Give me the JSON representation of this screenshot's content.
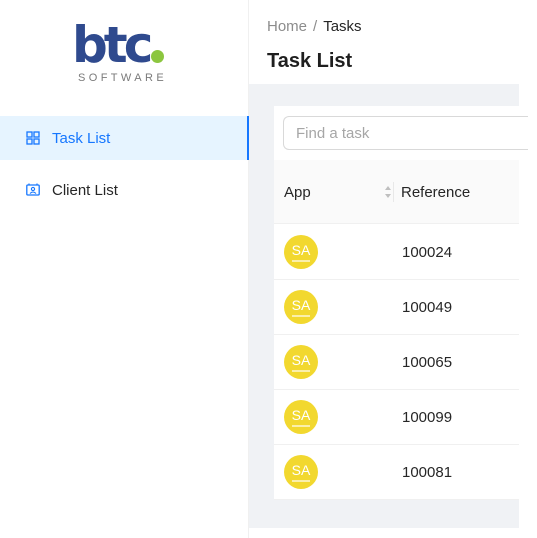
{
  "logo": {
    "wordmark": "btc",
    "subtitle": "SOFTWARE",
    "dot_color": "#8cc63f",
    "brand_color": "#2f4a8e"
  },
  "sidebar": {
    "items": [
      {
        "label": "Task List",
        "icon": "grid-icon",
        "active": true
      },
      {
        "label": "Client List",
        "icon": "contact-card-icon",
        "active": false
      }
    ]
  },
  "breadcrumb": {
    "home": "Home",
    "separator": "/",
    "current": "Tasks"
  },
  "page": {
    "title": "Task List"
  },
  "search": {
    "placeholder": "Find a task",
    "value": ""
  },
  "table": {
    "columns": [
      {
        "label": "App",
        "sortable": true
      },
      {
        "label": "Reference",
        "sortable": false
      }
    ],
    "rows": [
      {
        "app": "SA",
        "reference": "100024"
      },
      {
        "app": "SA",
        "reference": "100049"
      },
      {
        "app": "SA",
        "reference": "100065"
      },
      {
        "app": "SA",
        "reference": "100099"
      },
      {
        "app": "SA",
        "reference": "100081"
      }
    ]
  },
  "colors": {
    "accent": "#1677ff",
    "badge": "#f2d82f",
    "content_bg": "#f0f2f5"
  }
}
